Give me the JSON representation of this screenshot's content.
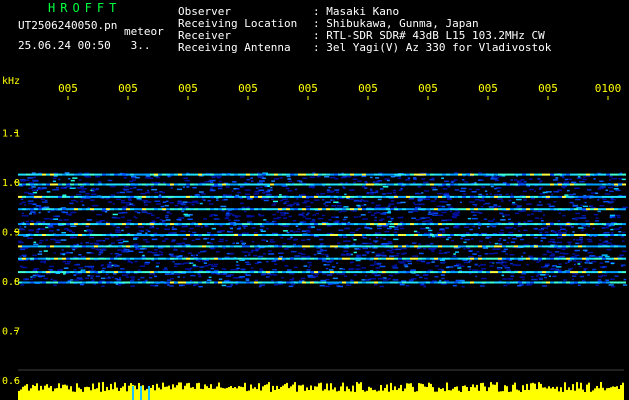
{
  "header": {
    "brand": "HROFFT",
    "file_name": "UT2506240050.pn",
    "file_tag": "meteor",
    "stamp_date": "25.06.24 00:50",
    "stamp_extra": "3..",
    "fields": [
      {
        "label": "Observer",
        "value": "Masaki Kano"
      },
      {
        "label": "Receiving Location",
        "value": "Shibukawa, Gunma, Japan"
      },
      {
        "label": "Receiver",
        "value": "RTL-SDR SDR# 43dB L15 103.2MHz CW"
      },
      {
        "label": "Receiving Antenna",
        "value": "3el Yagi(V) Az 330 for Vladivostok"
      }
    ]
  },
  "chart_data": {
    "type": "heatmap",
    "ylabel": "kHz",
    "yticks": [
      "1.1",
      "1.0",
      "0.9",
      "0.8",
      "0.7",
      "0.6"
    ],
    "yvalues": [
      1.1,
      1.0,
      0.9,
      0.8,
      0.7,
      0.6
    ],
    "ylim": [
      0.6,
      1.13
    ],
    "xticks": [
      "005",
      "005",
      "005",
      "005",
      "005",
      "005",
      "005",
      "005",
      "005",
      "0100"
    ],
    "noise_band_khz": [
      0.79,
      1.02
    ],
    "signal_lines_khz": [
      1.015,
      0.995,
      0.97,
      0.945,
      0.915,
      0.893,
      0.87,
      0.845,
      0.818,
      0.797
    ],
    "colors": {
      "label": "#ffff00",
      "brand": "#00ff40",
      "baseline": "#ffff00",
      "background": "#000000"
    }
  }
}
